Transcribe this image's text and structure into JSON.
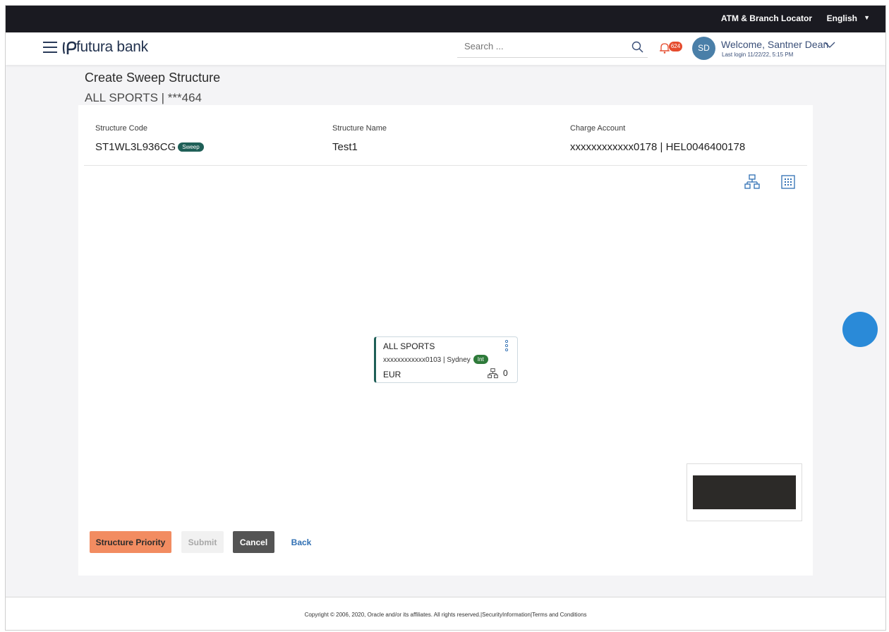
{
  "topbar": {
    "atm_locator": "ATM & Branch Locator",
    "language": "English"
  },
  "header": {
    "bank_name": "futura bank",
    "search_placeholder": "Search ...",
    "notification_count": "624",
    "avatar_initials": "SD",
    "welcome": "Welcome, Santner Dean",
    "last_login": "Last login 11/22/22, 5:15 PM"
  },
  "page": {
    "title": "Create Sweep Structure",
    "subtitle": "ALL SPORTS | ***464"
  },
  "structure": {
    "code_label": "Structure Code",
    "code_value": "ST1WL3L936CG",
    "code_badge": "Sweep",
    "name_label": "Structure Name",
    "name_value": "Test1",
    "charge_label": "Charge Account",
    "charge_value": "xxxxxxxxxxxx0178 | HEL0046400178"
  },
  "node": {
    "title": "ALL SPORTS",
    "account": "xxxxxxxxxxxx0103 | Sydney",
    "account_badge": "Int",
    "currency": "EUR",
    "child_count": "0"
  },
  "actions": {
    "structure_priority": "Structure Priority",
    "submit": "Submit",
    "cancel": "Cancel",
    "back": "Back"
  },
  "footer": {
    "text": "Copyright © 2006, 2020, Oracle and/or its affiliates. All rights reserved.|SecurityInformation|Terms and Conditions"
  },
  "colors": {
    "topbar": "#1a1a21",
    "primary_button": "#f28c61",
    "cancel_button": "#545454",
    "link": "#2f6fb3",
    "node_accent": "#1f5f57",
    "int_badge": "#2e7a3a",
    "notification_badge": "#e54b2d"
  },
  "icons": {
    "menu": "hamburger-icon",
    "logo": "futura-logo-icon",
    "search": "search-icon",
    "notifications": "bell-icon",
    "user_menu": "chevron-down-icon",
    "tree_view": "hierarchy-icon",
    "grid_view": "grid-icon",
    "node_menu": "kebab-icon",
    "node_children": "hierarchy-icon"
  }
}
